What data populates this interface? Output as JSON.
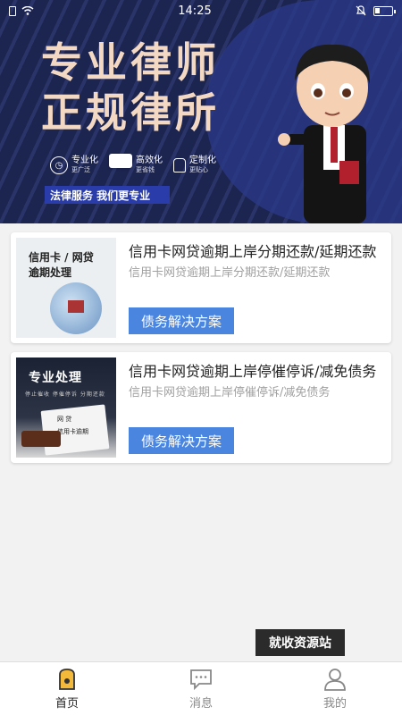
{
  "status_bar": {
    "time": "14:25"
  },
  "banner": {
    "title_line1": "专业律师",
    "title_line2": "正规律所",
    "features": [
      {
        "main": "专业化",
        "sub": "更广泛",
        "icon": "clock-icon"
      },
      {
        "main": "高效化",
        "sub": "更省钱",
        "icon": "card-icon"
      },
      {
        "main": "定制化",
        "sub": "更贴心",
        "icon": "lock-icon"
      }
    ],
    "tagline": "法律服务  我们更专业"
  },
  "cards": [
    {
      "thumb_title_line1": "信用卡 / 网贷",
      "thumb_title_line2": "逾期处理",
      "title": "信用卡网贷逾期上岸分期还款/延期还款",
      "desc": "信用卡网贷逾期上岸分期还款/延期还款",
      "button": "债务解决方案"
    },
    {
      "thumb_title": "专业处理",
      "thumb_sub": "停止催收 停催停诉 分期还款",
      "thumb_item1": "网 贷",
      "thumb_item2": "信用卡逾期",
      "title": "信用卡网贷逾期上岸停催停诉/减免债务",
      "desc": "信用卡网贷逾期上岸停催停诉/减免债务",
      "button": "债务解决方案"
    }
  ],
  "watermark": "就收资源站",
  "nav": [
    {
      "label": "首页",
      "icon": "home-icon",
      "active": true
    },
    {
      "label": "消息",
      "icon": "message-icon",
      "active": false
    },
    {
      "label": "我的",
      "icon": "user-icon",
      "active": false
    }
  ],
  "colors": {
    "accent": "#4a86e0",
    "banner_bg": "#1c2450",
    "title_color": "#f3d9c4"
  }
}
